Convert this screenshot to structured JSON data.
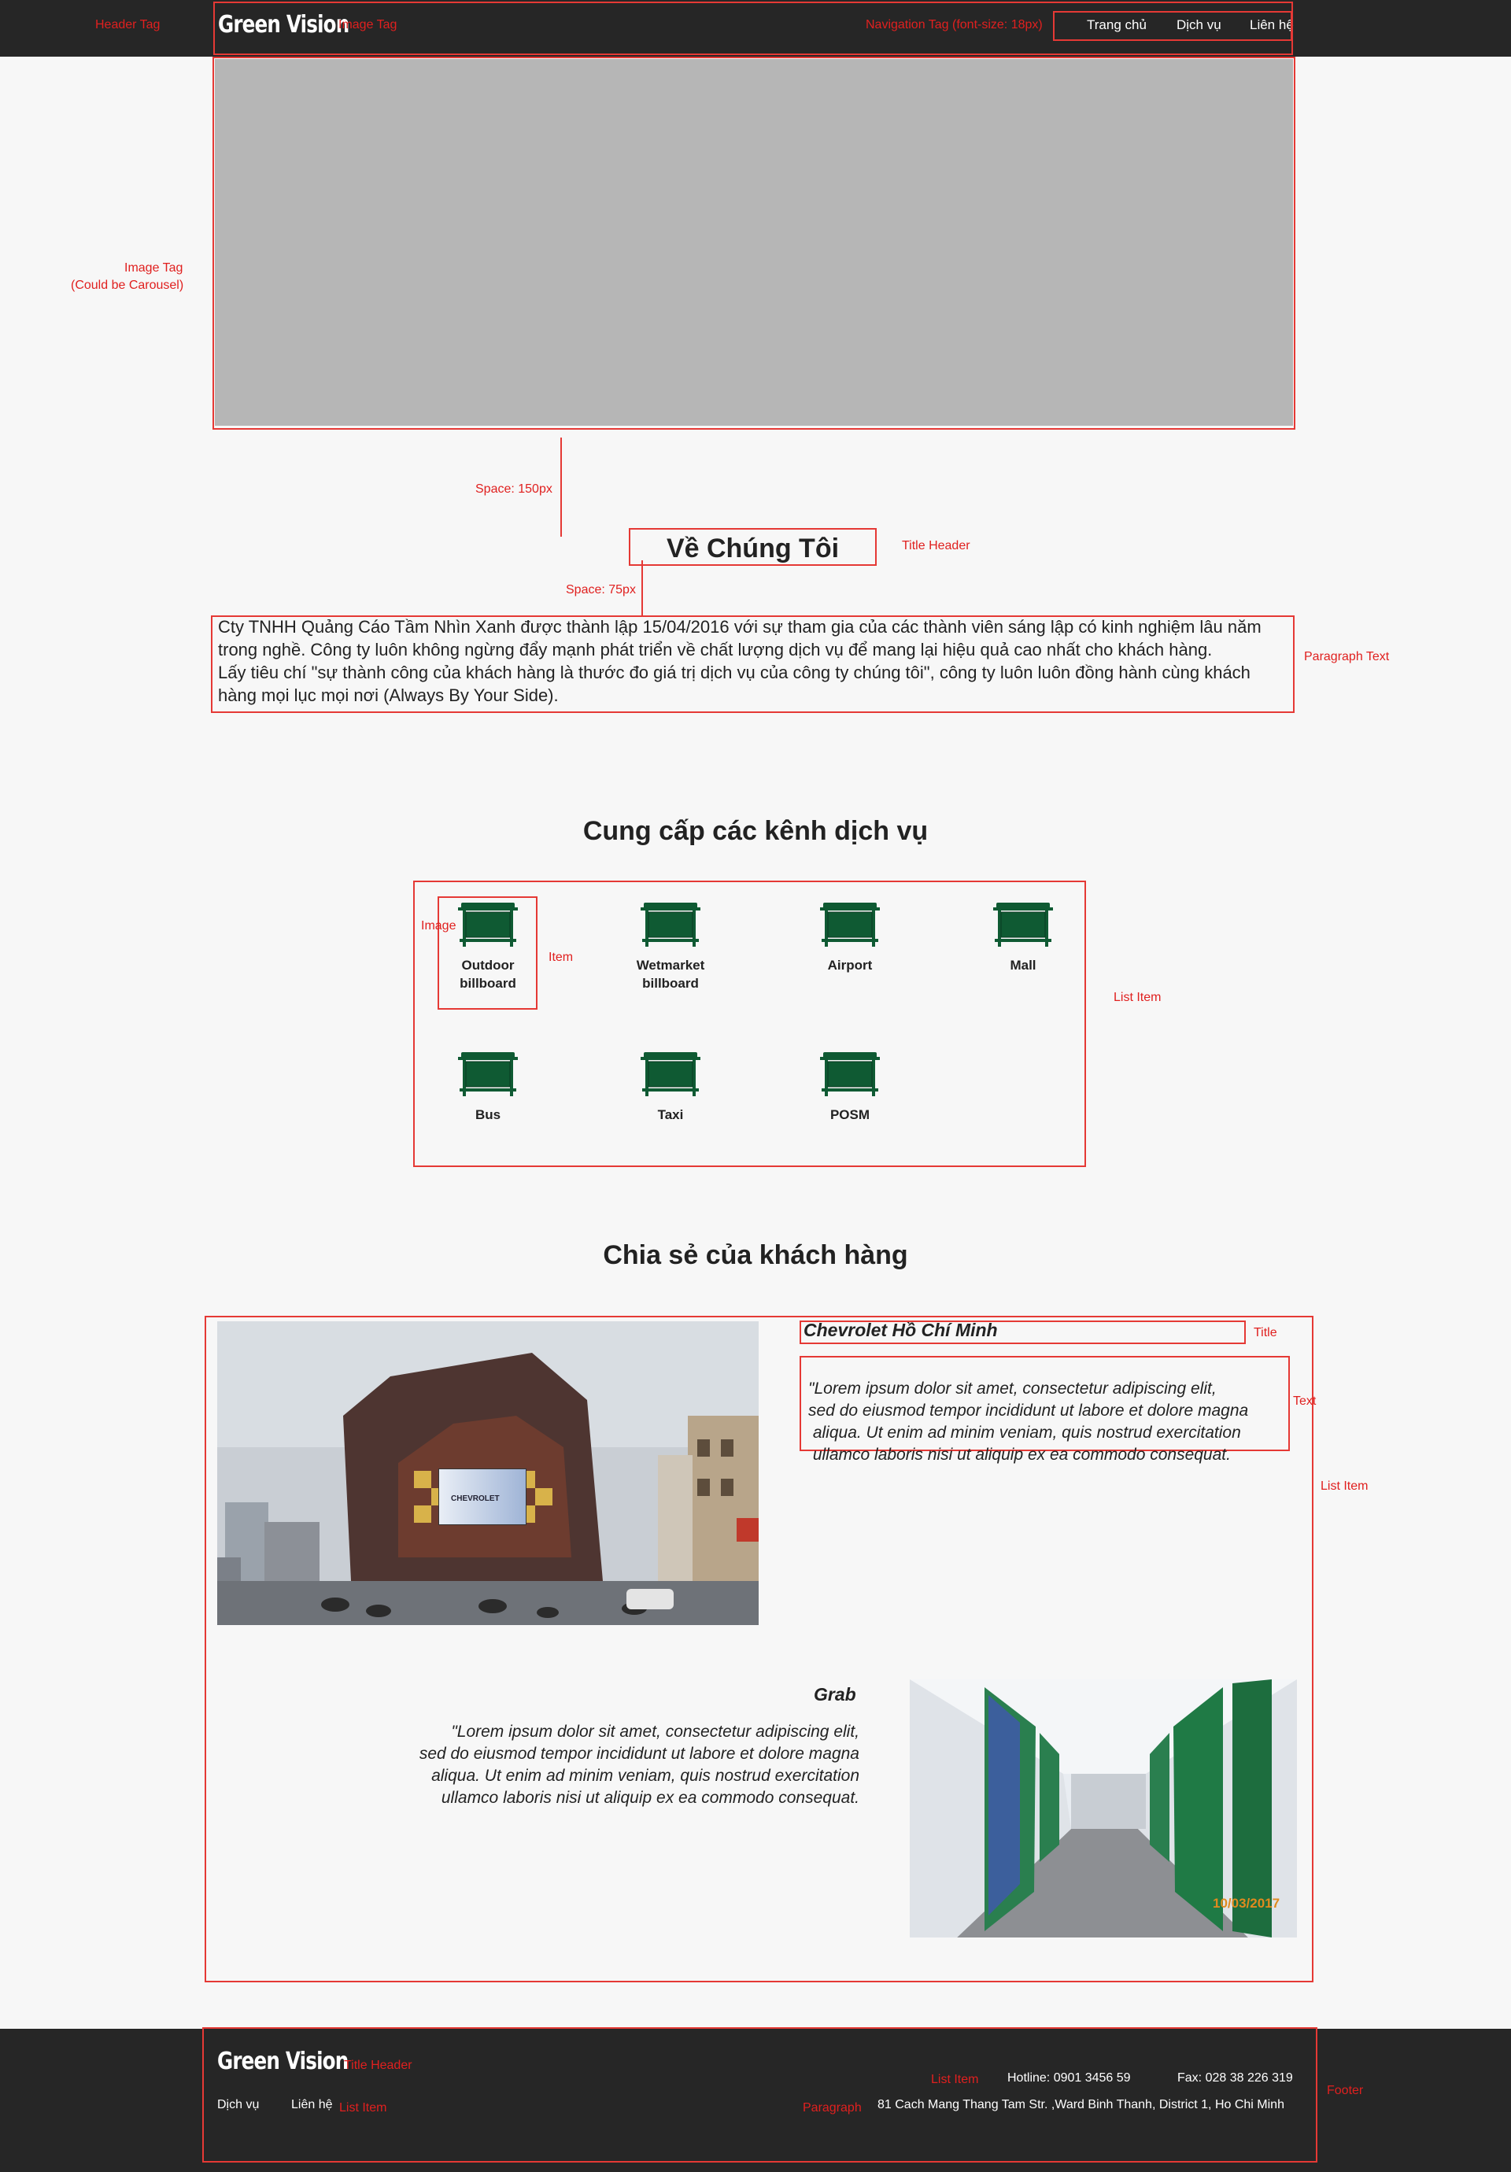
{
  "header": {
    "logo": "Green Vision",
    "nav": [
      "Trang chủ",
      "Dịch vụ",
      "Liên hệ"
    ]
  },
  "annotations": {
    "header_tag": "Header Tag",
    "image_tag": "Image Tag",
    "nav_tag": "Navigation Tag (font-size: 18px)",
    "hero_image_tag": "Image Tag",
    "hero_carousel": "(Could be Carousel)",
    "space_150": "Space: 150px",
    "title_header": "Title Header",
    "space_75": "Space: 75px",
    "paragraph_text": "Paragraph Text",
    "image": "Image",
    "item": "Item",
    "list_item": "List Item",
    "title": "Title",
    "text": "Text",
    "testimonial_list_item": "List Item",
    "footer_title_header": "Title Header",
    "footer_list_item_left": "List Item",
    "footer_list_item_right": "List Item",
    "footer_paragraph": "Paragraph",
    "footer": "Footer"
  },
  "about": {
    "title": "Về Chúng Tôi",
    "paragraph_lines": [
      "Cty TNHH Quảng Cáo Tầm Nhìn Xanh được thành lập 15/04/2016 với sự tham gia của các thành viên sáng lập có kinh nghiệm lâu năm",
      "trong nghề. Công ty luôn không ngừng đẩy mạnh phát triển về chất lượng dịch vụ để mang lại hiệu quả cao nhất cho khách hàng.",
      "Lấy tiêu chí \"sự thành công của khách hàng là thước đo giá trị dịch vụ của công ty chúng tôi\", công ty luôn luôn đồng hành cùng khách",
      "hàng mọi lục mọi nơi (Always By Your Side)."
    ]
  },
  "services": {
    "title": "Cung cấp các kênh dịch vụ",
    "items": [
      {
        "line1": "Outdoor",
        "line2": "billboard",
        "icon": "billboard-icon"
      },
      {
        "line1": "Wetmarket",
        "line2": "billboard",
        "icon": "billboard-icon"
      },
      {
        "line1": "Airport",
        "line2": "",
        "icon": "billboard-icon"
      },
      {
        "line1": "Mall",
        "line2": "",
        "icon": "billboard-icon"
      },
      {
        "line1": "Bus",
        "line2": "",
        "icon": "billboard-icon"
      },
      {
        "line1": "Taxi",
        "line2": "",
        "icon": "billboard-icon"
      },
      {
        "line1": "POSM",
        "line2": "",
        "icon": "billboard-icon"
      }
    ],
    "icon_color": "#0f5a33"
  },
  "testimonials": {
    "title": "Chia sẻ của khách hàng",
    "items": [
      {
        "name": "Chevrolet Hồ Chí Minh",
        "lines": [
          "\"Lorem ipsum dolor sit amet, consectetur adipiscing elit,",
          "sed do eiusmod tempor incididunt ut labore et dolore magna",
          " aliqua. Ut enim ad minim veniam, quis nostrud exercitation",
          " ullamco laboris nisi ut aliquip ex ea commodo consequat."
        ],
        "image_label": "CHEVROLET"
      },
      {
        "name": "Grab",
        "lines": [
          "\"Lorem ipsum dolor sit amet, consectetur adipiscing elit,",
          "sed do eiusmod tempor incididunt ut labore et dolore magna",
          "aliqua. Ut enim ad minim veniam, quis nostrud exercitation",
          "ullamco laboris nisi ut aliquip ex ea commodo consequat."
        ],
        "image_date": "10/03/2017"
      }
    ]
  },
  "footer": {
    "logo": "Green Vision",
    "links": [
      "Dịch vụ",
      "Liên hệ"
    ],
    "hotline": "Hotline: 0901 3456 59",
    "fax": "Fax: 028 38 226 319",
    "address": "81 Cach Mang Thang Tam Str. ,Ward Binh Thanh, District 1, Ho Chi Minh"
  },
  "colors": {
    "header_bg": "#262626",
    "page_bg": "#f7f7f7",
    "annotation": "#e53935",
    "brand_green": "#0f5a33"
  }
}
